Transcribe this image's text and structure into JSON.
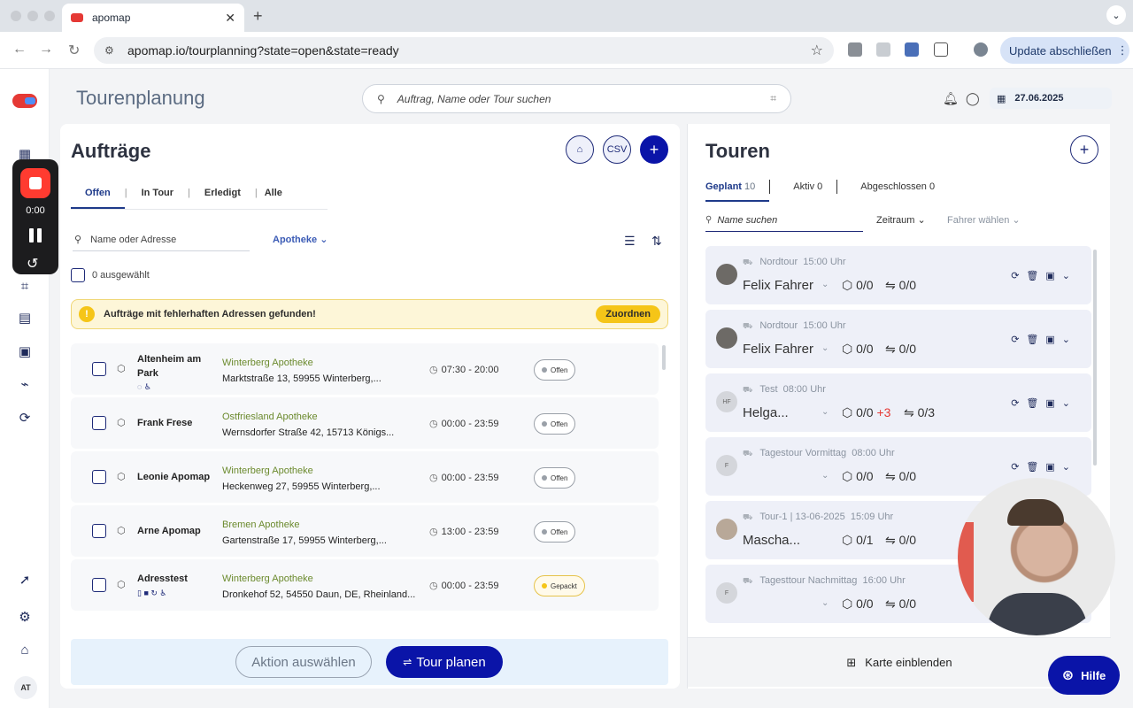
{
  "browser": {
    "tab_title": "apomap",
    "url": "apomap.io/tourplanning?state=open&state=ready",
    "update_label": "Update abschließen"
  },
  "header": {
    "page_title": "Tourenplanung",
    "search_placeholder": "Auftrag, Name oder Tour suchen",
    "date": "27.06.2025"
  },
  "recorder": {
    "time": "0:00"
  },
  "sidebar": {
    "user_initials": "AT"
  },
  "orders": {
    "title": "Aufträge",
    "tabs": [
      "Offen",
      "In Tour",
      "Erledigt",
      "Alle"
    ],
    "search_placeholder": "Name oder Adresse",
    "filter_apotheke": "Apotheke",
    "selected_label": "0 ausgewählt",
    "warning_text": "Aufträge mit fehlerhaften Adressen gefunden!",
    "warning_action": "Zuordnen",
    "items": [
      {
        "name": "Altenheim am Park",
        "pharmacy": "Winterberg Apotheke",
        "address": "Marktstraße 13, 59955 Winterberg,...",
        "time": "07:30 - 20:00",
        "status": "Offen",
        "icons": "◌ ♿"
      },
      {
        "name": "Frank Frese",
        "pharmacy": "Ostfriesland Apotheke",
        "address": "Wernsdorfer Straße 42, 15713 Königs...",
        "time": "00:00 - 23:59",
        "status": "Offen",
        "icons": ""
      },
      {
        "name": "Leonie Apomap",
        "pharmacy": "Winterberg Apotheke",
        "address": "Heckenweg 27, 59955 Winterberg,...",
        "time": "00:00 - 23:59",
        "status": "Offen",
        "icons": ""
      },
      {
        "name": "Arne Apomap",
        "pharmacy": "Bremen Apotheke",
        "address": "Gartenstraße 17, 59955 Winterberg,...",
        "time": "13:00 - 23:59",
        "status": "Offen",
        "icons": ""
      },
      {
        "name": "Adresstest",
        "pharmacy": "Winterberg Apotheke",
        "address": "Dronkehof 52, 54550 Daun, DE, Rheinland...",
        "time": "00:00 - 23:59",
        "status": "Gepackt",
        "icons": "▯ ■ ↻ ♿"
      }
    ],
    "action_select": "Aktion auswählen",
    "plan_tour": "Tour planen"
  },
  "tours": {
    "title": "Touren",
    "tabs": [
      {
        "label": "Geplant",
        "count": "10"
      },
      {
        "label": "Aktiv",
        "count": "0"
      },
      {
        "label": "Abgeschlossen",
        "count": "0"
      }
    ],
    "search_placeholder": "Name suchen",
    "filter_period": "Zeitraum",
    "filter_driver": "Fahrer wählen",
    "items": [
      {
        "name": "Nordtour",
        "time": "15:00 Uhr",
        "driver": "Felix Fahrer",
        "avatar": "",
        "packages": "0/0",
        "extra": "",
        "stops": "0/0"
      },
      {
        "name": "Nordtour",
        "time": "15:00 Uhr",
        "driver": "Felix Fahrer",
        "avatar": "",
        "packages": "0/0",
        "extra": "",
        "stops": "0/0"
      },
      {
        "name": "Test",
        "time": "08:00 Uhr",
        "driver": "Helga...",
        "avatar": "HF",
        "packages": "0/0",
        "extra": "+3",
        "stops": "0/3"
      },
      {
        "name": "Tagestour Vormittag",
        "time": "08:00 Uhr",
        "driver": "",
        "avatar": "F",
        "packages": "0/0",
        "extra": "",
        "stops": "0/0"
      },
      {
        "name": "Tour-1 | 13-06-2025",
        "time": "15:09 Uhr",
        "driver": "Mascha...",
        "avatar": "",
        "packages": "0/1",
        "extra": "",
        "stops": "0/0"
      },
      {
        "name": "Tagesttour Nachmittag",
        "time": "16:00 Uhr",
        "driver": "",
        "avatar": "F",
        "packages": "0/0",
        "extra": "",
        "stops": "0/0"
      }
    ],
    "map_toggle": "Karte einblenden"
  },
  "help_label": "Hilfe"
}
